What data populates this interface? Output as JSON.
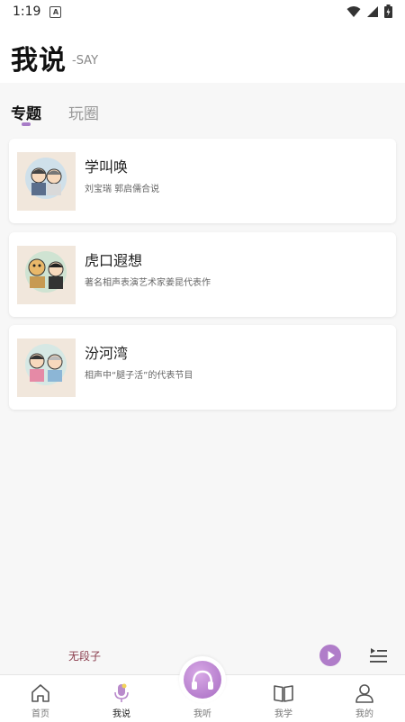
{
  "status_bar": {
    "time": "1:19",
    "notification_letter": "A"
  },
  "header": {
    "title": "我说",
    "subtitle": "-SAY"
  },
  "tabs": [
    {
      "label": "专题",
      "active": true
    },
    {
      "label": "玩圈",
      "active": false
    }
  ],
  "cards": [
    {
      "title": "学叫唤",
      "description": "刘宝瑞 郭启儒合说",
      "thumb_caption": "学叫唤"
    },
    {
      "title": "虎口遐想",
      "description": "著名相声表演艺术家姜昆代表作",
      "thumb_caption": "虎口遐想"
    },
    {
      "title": "汾河湾",
      "description": "相声中“腿子活”的代表节目",
      "thumb_caption": "汾河湾"
    }
  ],
  "player": {
    "track_text": "无段子"
  },
  "bottom_nav": [
    {
      "label": "首页",
      "icon": "home-icon",
      "active": false
    },
    {
      "label": "我说",
      "icon": "microphone-icon",
      "active": true
    },
    {
      "label": "我听",
      "icon": "headphones-icon",
      "active": false
    },
    {
      "label": "我学",
      "icon": "book-icon",
      "active": false
    },
    {
      "label": "我的",
      "icon": "user-icon",
      "active": false
    }
  ],
  "colors": {
    "accent": "#a77bc7",
    "player_text": "#8a3c4c",
    "thumb_bg": "#f1e7dc"
  }
}
